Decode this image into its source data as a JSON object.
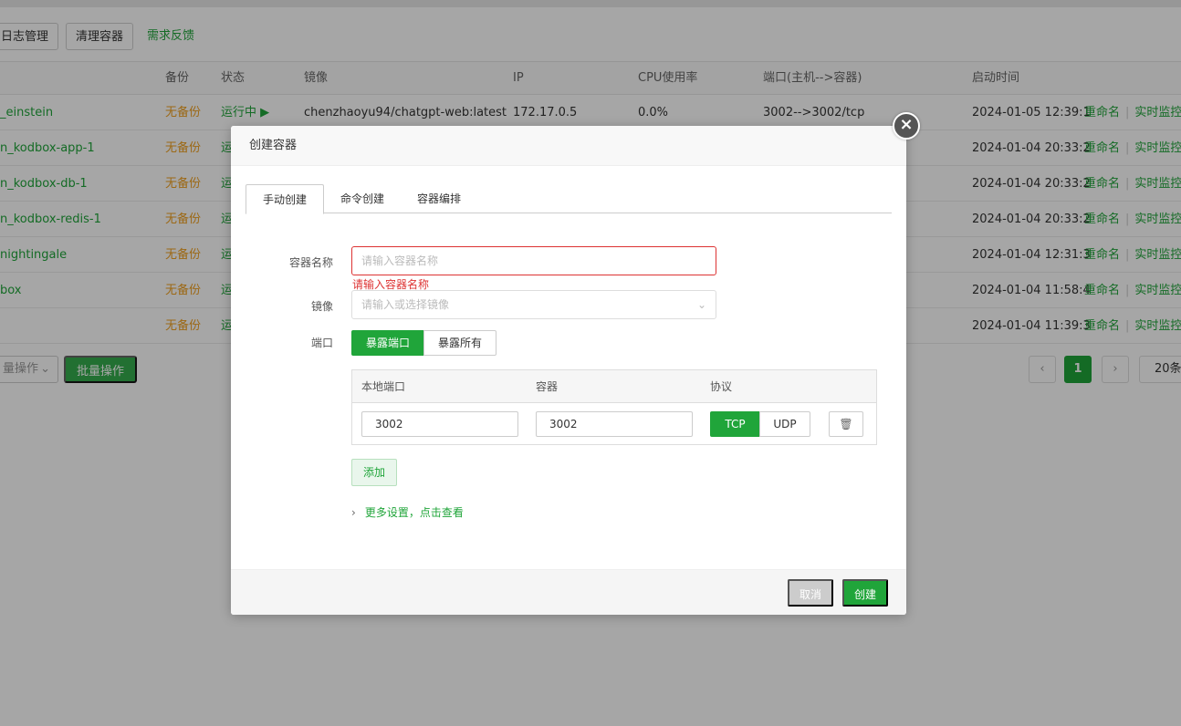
{
  "toolbar": {
    "log_btn": "日志管理",
    "clean_btn": "清理容器",
    "feedback_link": "需求反馈"
  },
  "table": {
    "headers": [
      "备份",
      "状态",
      "镜像",
      "IP",
      "CPU使用率",
      "端口(主机-->容器)",
      "启动时间"
    ],
    "rows": [
      {
        "name": "_einstein",
        "backup": "无备份",
        "status": "运行中 ▶",
        "image": "chenzhaoyu94/chatgpt-web:latest",
        "ip": "172.17.0.5",
        "cpu": "0.0%",
        "ports": "3002-->3002/tcp",
        "time": "2024-01-05 12:39:1"
      },
      {
        "name": "n_kodbox-app-1",
        "backup": "无备份",
        "status": "运",
        "time": "2024-01-04 20:33:2"
      },
      {
        "name": "n_kodbox-db-1",
        "backup": "无备份",
        "status": "运",
        "time": "2024-01-04 20:33:2"
      },
      {
        "name": "n_kodbox-redis-1",
        "backup": "无备份",
        "status": "运",
        "time": "2024-01-04 20:33:2"
      },
      {
        "name": "nightingale",
        "backup": "无备份",
        "status": "运",
        "time": "2024-01-04 12:31:3"
      },
      {
        "name": "box",
        "backup": "无备份",
        "status": "运",
        "time": "2024-01-04 11:58:4"
      },
      {
        "name": "",
        "backup": "无备份",
        "status": "运",
        "time": "2024-01-04 11:39:3"
      }
    ],
    "rename": "重命名",
    "monitor": "实时监控"
  },
  "batch": {
    "select_label": "量操作",
    "btn_label": "批量操作"
  },
  "pagination": {
    "prev": "‹",
    "current": "1",
    "next": "›",
    "size": "20条"
  },
  "modal": {
    "title": "创建容器",
    "close": "×",
    "tabs": [
      "手动创建",
      "命令创建",
      "容器编排"
    ],
    "name_label": "容器名称",
    "name_placeholder": "请输入容器名称",
    "name_error": "请输入容器名称",
    "image_label": "镜像",
    "image_placeholder": "请输入或选择镜像",
    "port_label": "端口",
    "expose_port": "暴露端口",
    "expose_all": "暴露所有",
    "port_headers": [
      "本地端口",
      "容器",
      "协议"
    ],
    "local_port": "3002",
    "container_port": "3002",
    "tcp": "TCP",
    "udp": "UDP",
    "add": "添加",
    "more_settings": "更多设置，点击查看",
    "cancel": "取消",
    "create": "创建"
  }
}
